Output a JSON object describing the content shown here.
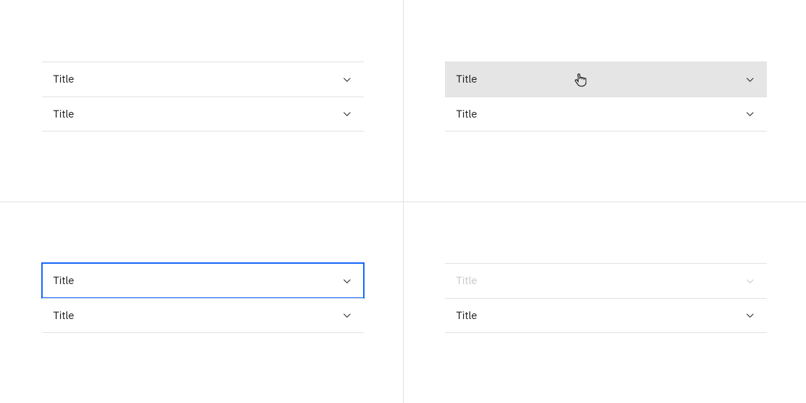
{
  "quadrants": {
    "default": {
      "items": [
        {
          "label": "Title"
        },
        {
          "label": "Title"
        }
      ]
    },
    "hover": {
      "items": [
        {
          "label": "Title"
        },
        {
          "label": "Title"
        }
      ]
    },
    "focus": {
      "items": [
        {
          "label": "Title"
        },
        {
          "label": "Title"
        }
      ]
    },
    "disabled": {
      "items": [
        {
          "label": "Title"
        },
        {
          "label": "Title"
        }
      ]
    }
  },
  "colors": {
    "focus": "#0f62fe",
    "hover_bg": "#e5e5e5",
    "border": "#e0e0e0",
    "text": "#161616",
    "disabled": "#c6c6c6"
  }
}
